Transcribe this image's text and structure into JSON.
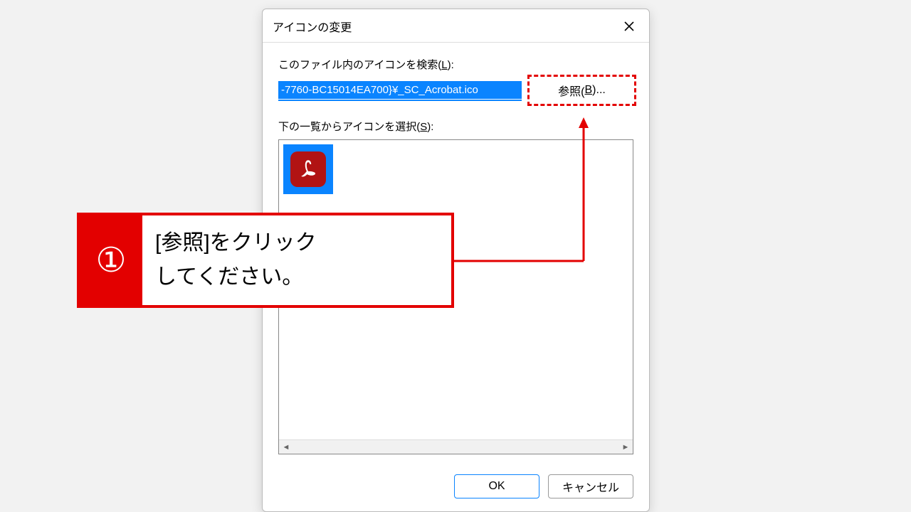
{
  "dialog": {
    "title": "アイコンの変更",
    "label_search_prefix": "このファイル内のアイコンを検索(",
    "label_search_access": "L",
    "label_search_suffix": "):",
    "path_value": "-7760-BC15014EA700}¥_SC_Acrobat.ico",
    "browse_prefix": "参照(",
    "browse_access": "B",
    "browse_suffix": ")...",
    "label_select_prefix": "下の一覧からアイコンを選択(",
    "label_select_access": "S",
    "label_select_suffix": "):",
    "ok": "OK",
    "cancel": "キャンセル"
  },
  "icons": {
    "item0_name": "acrobat-icon"
  },
  "callout": {
    "num": "①",
    "line1": "[参照]をクリック",
    "line2": "してください。"
  }
}
